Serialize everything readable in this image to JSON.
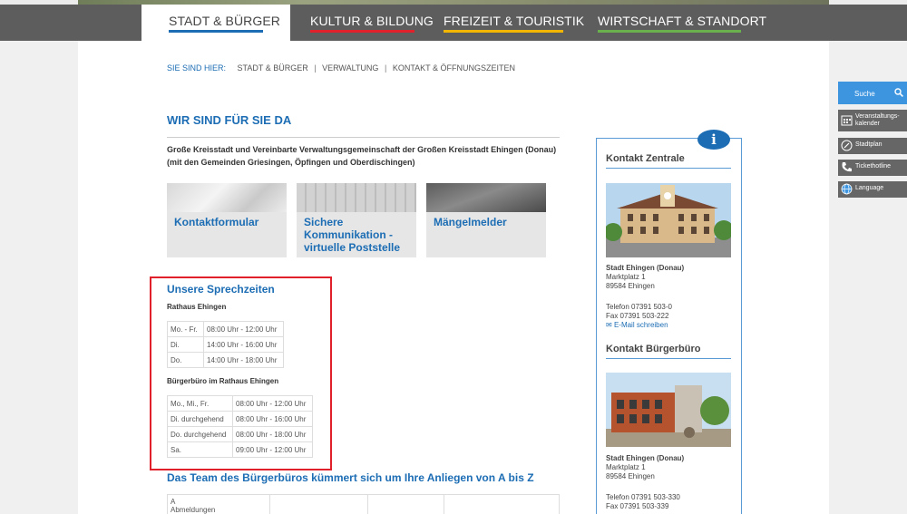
{
  "nav": {
    "items": [
      {
        "label": "STADT & BÜRGER",
        "color": "#1c6db4",
        "active": true
      },
      {
        "label": "KULTUR & BILDUNG",
        "color": "#e0202a",
        "active": false
      },
      {
        "label": "FREIZEIT & TOURISTIK",
        "color": "#f2b500",
        "active": false
      },
      {
        "label": "WIRTSCHAFT & STANDORT",
        "color": "#6ab04c",
        "active": false
      }
    ]
  },
  "breadcrumb": {
    "prefix": "SIE SIND HIER:",
    "items": [
      "STADT & BÜRGER",
      "VERWALTUNG",
      "KONTAKT & ÖFFNUNGSZEITEN"
    ],
    "separator": "|"
  },
  "main": {
    "title": "WIR SIND FÜR SIE DA",
    "intro": "Große Kreisstadt und Vereinbarte Verwaltungsgemeinschaft der Großen Kreisstadt Ehingen (Donau) (mit den Gemeinden Griesingen, Öpfingen und Oberdischingen)",
    "tiles": [
      {
        "label": "Kontaktformular"
      },
      {
        "label": "Sichere Kommunikation - virtuelle Poststelle"
      },
      {
        "label": "Mängelmelder"
      }
    ]
  },
  "hours": {
    "title": "Unsere Sprechzeiten",
    "rathaus": {
      "heading": "Rathaus Ehingen",
      "rows": [
        {
          "day": "Mo. - Fr.",
          "time": "08:00 Uhr - 12:00 Uhr"
        },
        {
          "day": "Di.",
          "time": "14:00 Uhr - 16:00 Uhr"
        },
        {
          "day": "Do.",
          "time": "14:00 Uhr - 18:00 Uhr"
        }
      ]
    },
    "buergerbuero": {
      "heading": "Bürgerbüro im Rathaus Ehingen",
      "rows": [
        {
          "day": "Mo., Mi., Fr.",
          "time": "08:00 Uhr - 12:00 Uhr"
        },
        {
          "day": "Di. durchgehend",
          "time": "08:00 Uhr - 16:00 Uhr"
        },
        {
          "day": "Do. durchgehend",
          "time": "08:00 Uhr - 18:00 Uhr"
        },
        {
          "day": "Sa.",
          "time": "09:00 Uhr - 12:00 Uhr"
        }
      ]
    }
  },
  "team": {
    "title": "Das Team des Bürgerbüros kümmert sich um Ihre Anliegen von A bis Z",
    "first_cell_letter": "A",
    "first_cell_text": "Abmeldungen"
  },
  "info": {
    "badge": "i",
    "zentrale": {
      "heading": "Kontakt Zentrale",
      "name": "Stadt Ehingen (Donau)",
      "street": "Marktplatz 1",
      "city": "89584 Ehingen",
      "phone": "Telefon 07391 503-0",
      "fax": "Fax 07391 503-222",
      "email": "E-Mail schreiben"
    },
    "buergerbuero": {
      "heading": "Kontakt Bürgerbüro",
      "name": "Stadt Ehingen (Donau)",
      "street": "Marktplatz 1",
      "city": "89584 Ehingen",
      "phone": "Telefon 07391 503-330",
      "fax": "Fax 07391 503-339"
    }
  },
  "sidebar": {
    "search": "Suche",
    "items": [
      {
        "label1": "Veranstaltungs-",
        "label2": "kalender",
        "icon": "calendar-icon"
      },
      {
        "label1": "Stadtplan",
        "label2": "",
        "icon": "compass-icon"
      },
      {
        "label1": "Tickethotline",
        "label2": "",
        "icon": "phone-icon"
      },
      {
        "label1": "Language",
        "label2": "",
        "icon": "globe-icon"
      }
    ]
  }
}
